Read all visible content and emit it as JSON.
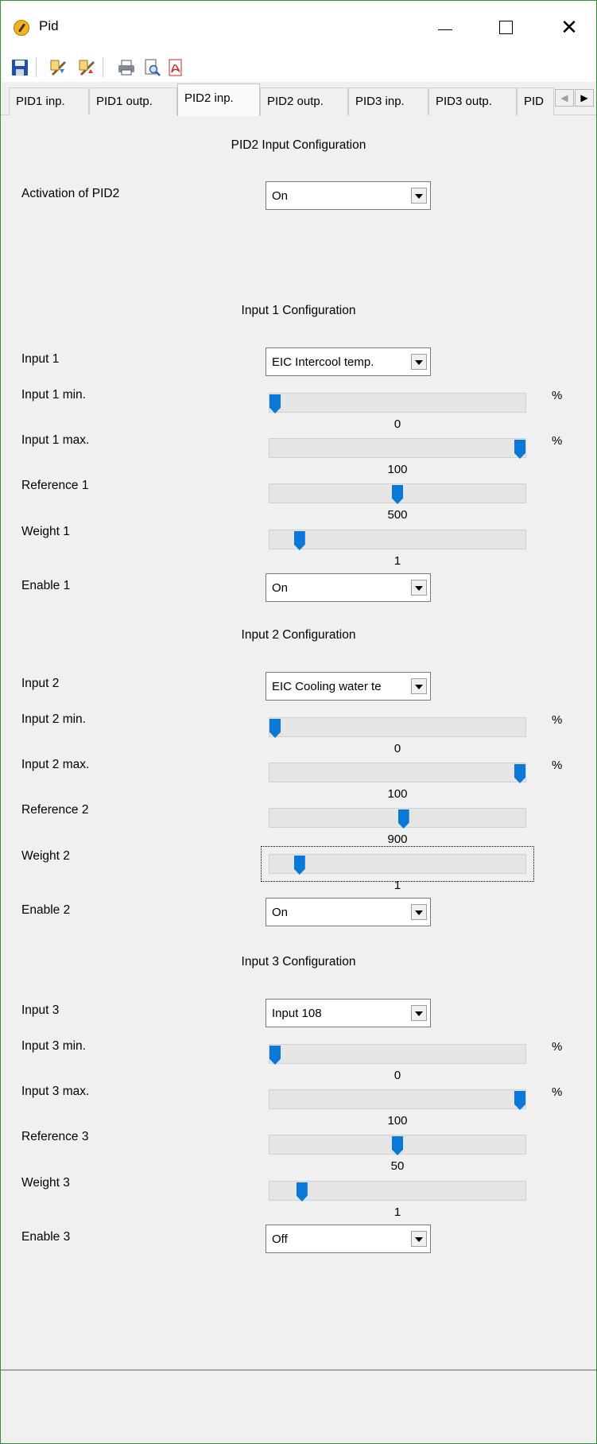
{
  "window": {
    "title": "Pid",
    "minimize_icon": "minimize-icon",
    "maximize_icon": "maximize-icon",
    "close_glyph": "✕"
  },
  "toolbar": {
    "icons": [
      "save-icon",
      "import-icon",
      "export-icon",
      "print-icon",
      "print-preview-icon",
      "pdf-icon"
    ]
  },
  "tabs": {
    "items": [
      "PID1 inp.",
      "PID1 outp.",
      "PID2 inp.",
      "PID2 outp.",
      "PID3 inp.",
      "PID3 outp.",
      "PID"
    ],
    "active": "PID2 inp.",
    "scroll_left": "◀",
    "scroll_right": "▶"
  },
  "main": {
    "heading": "PID2 Input Configuration",
    "activation_label": "Activation of PID2",
    "activation_value": "On"
  },
  "inputs": [
    {
      "heading": "Input 1 Configuration",
      "input_label": "Input 1",
      "input_value": "EIC Intercool temp.",
      "min_label": "Input 1 min.",
      "min_value": "0",
      "min_pos": 0.0,
      "min_unit": "%",
      "max_label": "Input 1 max.",
      "max_value": "100",
      "max_pos": 1.0,
      "max_unit": "%",
      "ref_label": "Reference 1",
      "ref_value": "500",
      "ref_pos": 0.5,
      "weight_label": "Weight 1",
      "weight_value": "1",
      "weight_pos": 0.1,
      "enable_label": "Enable 1",
      "enable_value": "On"
    },
    {
      "heading": "Input 2 Configuration",
      "input_label": "Input 2",
      "input_value": "EIC Cooling water te",
      "min_label": "Input 2 min.",
      "min_value": "0",
      "min_pos": 0.0,
      "min_unit": "%",
      "max_label": "Input 2 max.",
      "max_value": "100",
      "max_pos": 1.0,
      "max_unit": "%",
      "ref_label": "Reference 2",
      "ref_value": "900",
      "ref_pos": 0.525,
      "weight_label": "Weight 2",
      "weight_value": "1",
      "weight_pos": 0.1,
      "enable_label": "Enable 2",
      "enable_value": "On"
    },
    {
      "heading": "Input 3 Configuration",
      "input_label": "Input 3",
      "input_value": "Input 108",
      "min_label": "Input 3 min.",
      "min_value": "0",
      "min_pos": 0.0,
      "min_unit": "%",
      "max_label": "Input 3 max.",
      "max_value": "100",
      "max_pos": 1.0,
      "max_unit": "%",
      "ref_label": "Reference 3",
      "ref_value": "50",
      "ref_pos": 0.5,
      "weight_label": "Weight 3",
      "weight_value": "1",
      "weight_pos": 0.11,
      "enable_label": "Enable 3",
      "enable_value": "Off"
    }
  ],
  "colors": {
    "slider_thumb": "#0a78d7",
    "window_border": "#3a8a3a",
    "app_icon": "#f2b21b"
  }
}
